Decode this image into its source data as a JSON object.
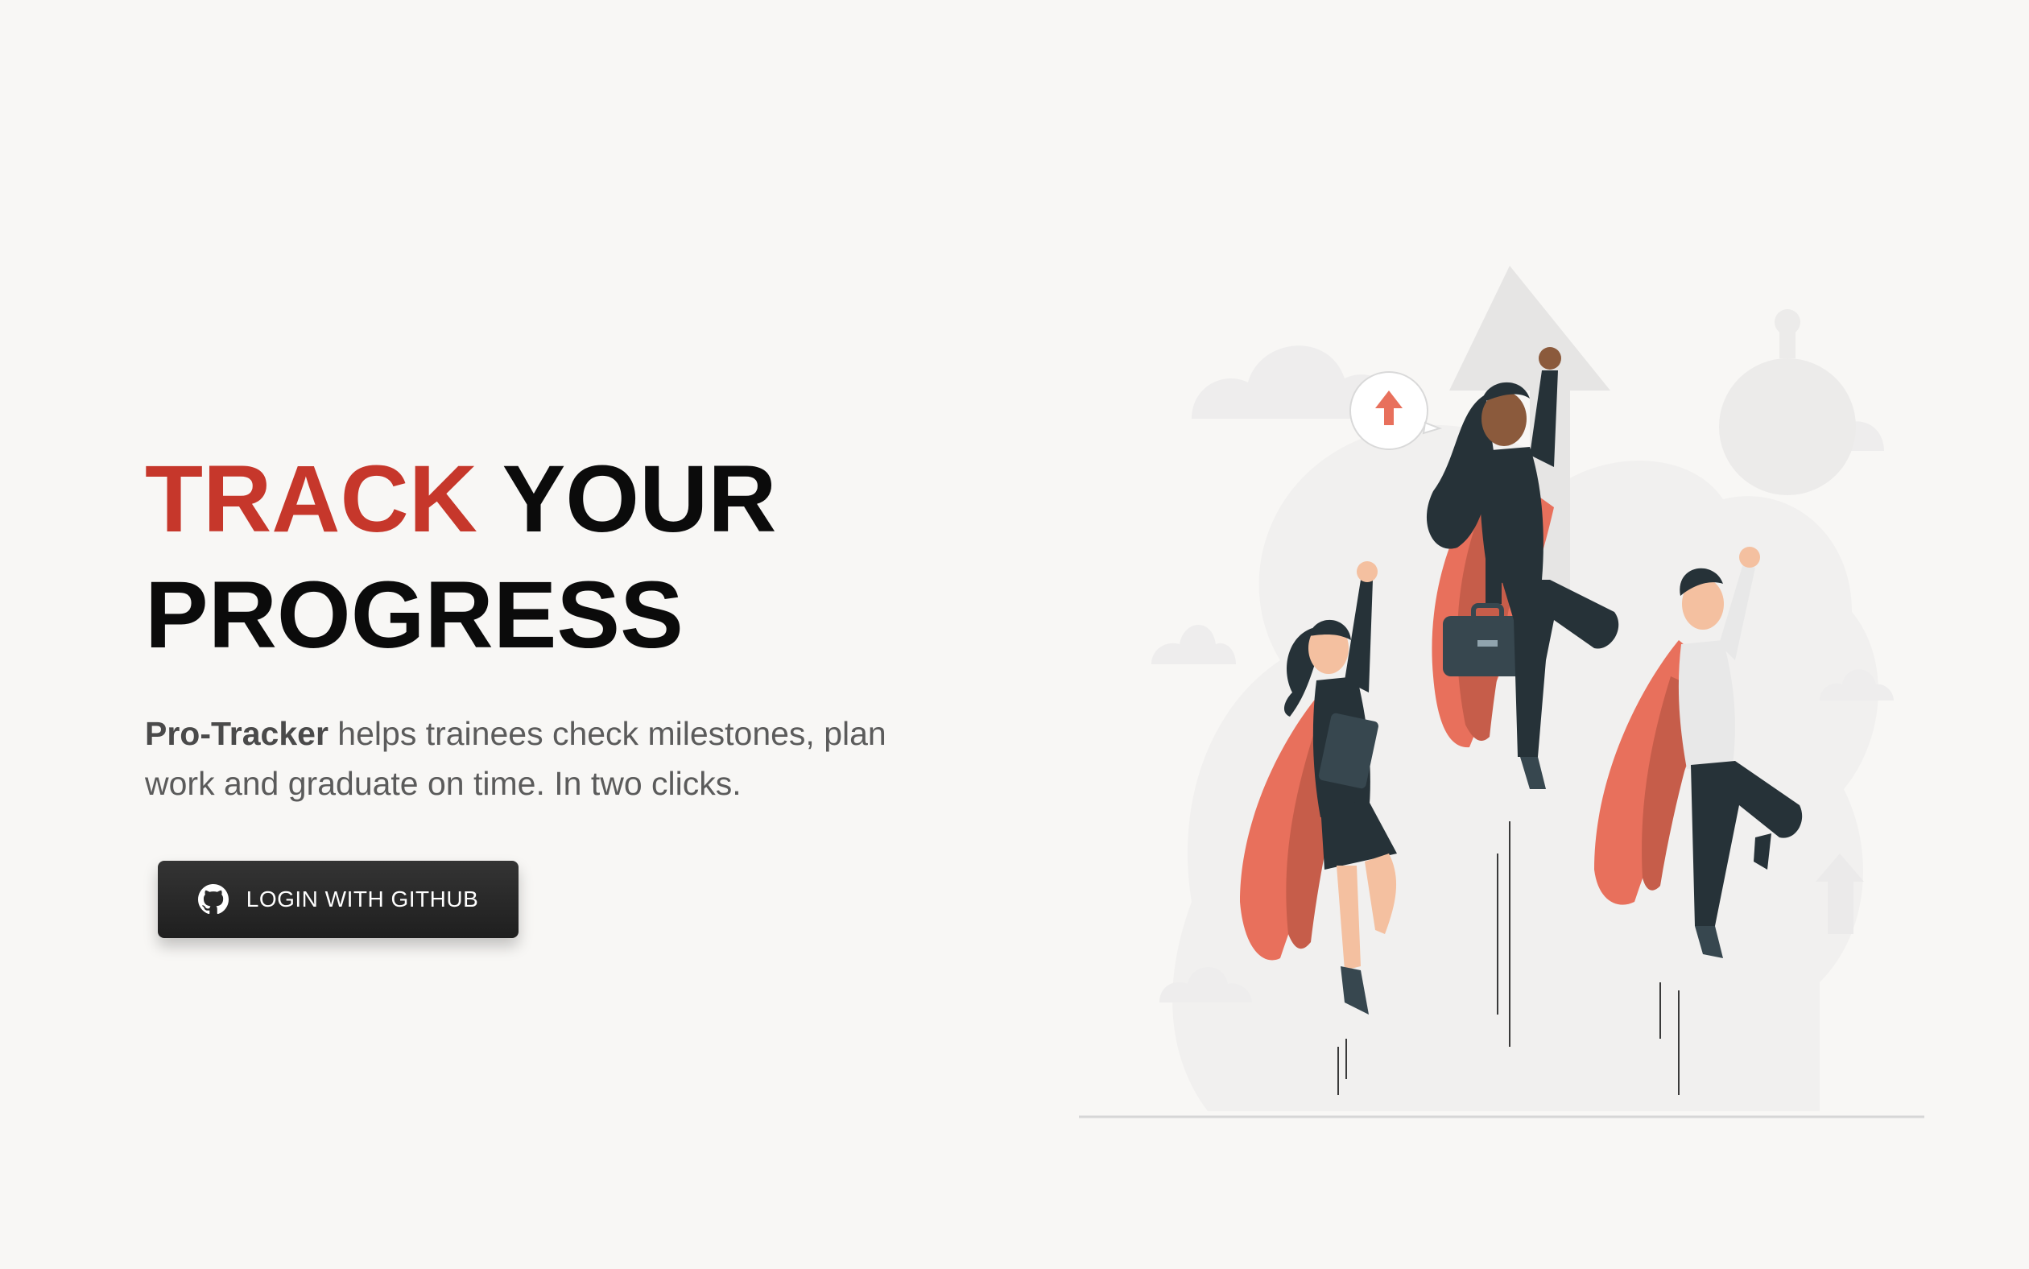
{
  "hero": {
    "headline_accent": "TRACK",
    "headline_line1_rest": " YOUR",
    "headline_line2": "PROGRESS",
    "tagline_brand": "Pro-Tracker",
    "tagline_rest": " helps trainees check milestones, plan work and graduate on time. In two clicks."
  },
  "login": {
    "label": "LOGIN WITH GITHUB",
    "icon": "github-icon"
  },
  "illustration": {
    "name": "superheroes-illustration",
    "badge_icon": "arrow-up-icon"
  },
  "colors": {
    "accent": "#c6372b",
    "background": "#f8f7f5",
    "button": "#262626",
    "cape": "#e8705c"
  }
}
